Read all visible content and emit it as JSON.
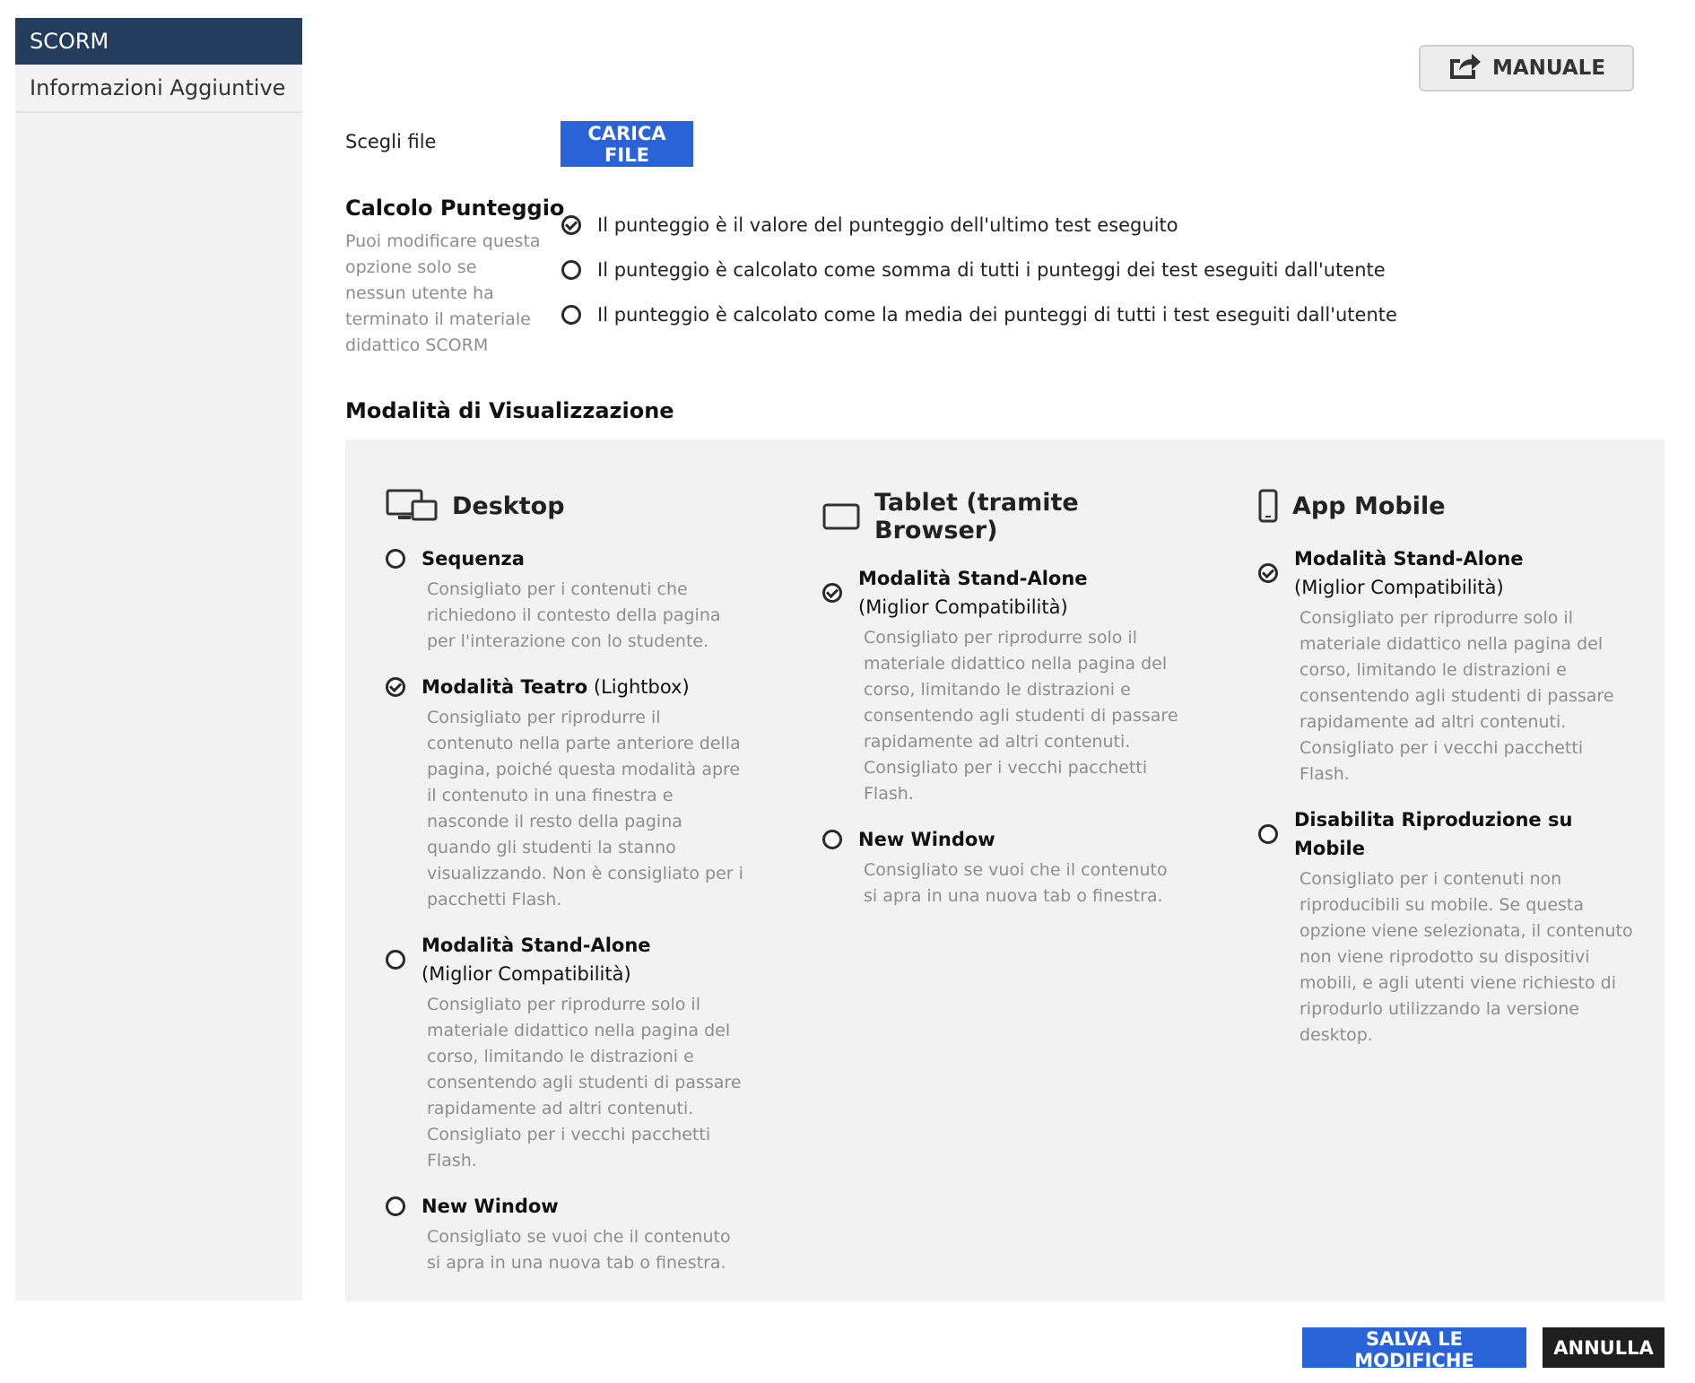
{
  "sidebar": {
    "items": [
      {
        "label": "SCORM",
        "active": true
      },
      {
        "label": "Informazioni Aggiuntive",
        "active": false
      }
    ]
  },
  "header": {
    "manual_label": "MANUALE",
    "manual_icon": "share-icon"
  },
  "file": {
    "label": "Scegli file",
    "upload_label": "CARICA FILE"
  },
  "score": {
    "title": "Calcolo Punteggio",
    "description": "Puoi modificare questa opzione solo se nessun utente ha terminato il materiale didattico SCORM",
    "options": [
      {
        "label": "Il punteggio è il valore del punteggio dell'ultimo test eseguito",
        "selected": true
      },
      {
        "label": "Il punteggio è calcolato come somma di tutti i punteggi dei test eseguiti dall'utente",
        "selected": false
      },
      {
        "label": "Il punteggio è calcolato come la media dei punteggi di tutti i test eseguiti dall'utente",
        "selected": false
      }
    ]
  },
  "display": {
    "title": "Modalità di Visualizzazione",
    "desktop": {
      "title": "Desktop",
      "icon": "desktop-icon",
      "options": [
        {
          "title_bold": "Sequenza",
          "title_rest": "",
          "selected": false,
          "desc": "Consigliato per i contenuti che richiedono il contesto della pagina per l'interazione con lo studente."
        },
        {
          "title_bold": "Modalità Teatro",
          "title_rest": "(Lightbox)",
          "selected": true,
          "desc": "Consigliato per riprodurre il contenuto nella parte anteriore della pagina, poiché questa modalità apre il contenuto in una finestra e nasconde il resto della pagina quando gli studenti la stanno visualizzando. Non è consigliato per i pacchetti Flash."
        },
        {
          "title_bold": "Modalità Stand-Alone",
          "title_rest": "(Miglior Compatibilità)",
          "selected": false,
          "desc": "Consigliato per riprodurre solo il materiale didattico nella pagina del corso, limitando le distrazioni e consentendo agli studenti di passare rapidamente ad altri contenuti. Consigliato per i vecchi pacchetti Flash."
        },
        {
          "title_bold": "New Window",
          "title_rest": "",
          "selected": false,
          "desc": "Consigliato se vuoi che il contenuto si apra in una nuova tab o finestra."
        }
      ]
    },
    "tablet": {
      "title": "Tablet (tramite Browser)",
      "icon": "tablet-icon",
      "options": [
        {
          "title_bold": "Modalità Stand-Alone",
          "title_rest": "(Miglior Compatibilità)",
          "selected": true,
          "desc": "Consigliato per riprodurre solo il materiale didattico nella pagina del corso, limitando le distrazioni e consentendo agli studenti di passare rapidamente ad altri contenuti. Consigliato per i vecchi pacchetti Flash."
        },
        {
          "title_bold": "New Window",
          "title_rest": "",
          "selected": false,
          "desc": "Consigliato se vuoi che il contenuto si apra in una nuova tab o finestra."
        }
      ]
    },
    "mobile": {
      "title": "App Mobile",
      "icon": "smartphone-icon",
      "options": [
        {
          "title_bold": "Modalità Stand-Alone",
          "title_rest": "(Miglior Compatibilità)",
          "selected": true,
          "desc": "Consigliato per riprodurre solo il materiale didattico nella pagina del corso, limitando le distrazioni e consentendo agli studenti di passare rapidamente ad altri contenuti. Consigliato per i vecchi pacchetti Flash."
        },
        {
          "title_bold": "Disabilita Riproduzione su Mobile",
          "title_rest": "",
          "selected": false,
          "desc": "Consigliato per i contenuti non riproducibili su mobile. Se questa opzione viene selezionata, il contenuto non viene riprodotto su dispositivi mobili, e agli utenti viene richiesto di riprodurlo utilizzando la versione desktop."
        }
      ]
    }
  },
  "footer": {
    "save_label": "SALVA LE MODIFICHE",
    "cancel_label": "ANNULLA"
  },
  "colors": {
    "primary_blue": "#2a62d8",
    "sidebar_active": "#243d5e",
    "panel_bg": "#f1f2f1",
    "muted_text": "#8d8d8d"
  }
}
